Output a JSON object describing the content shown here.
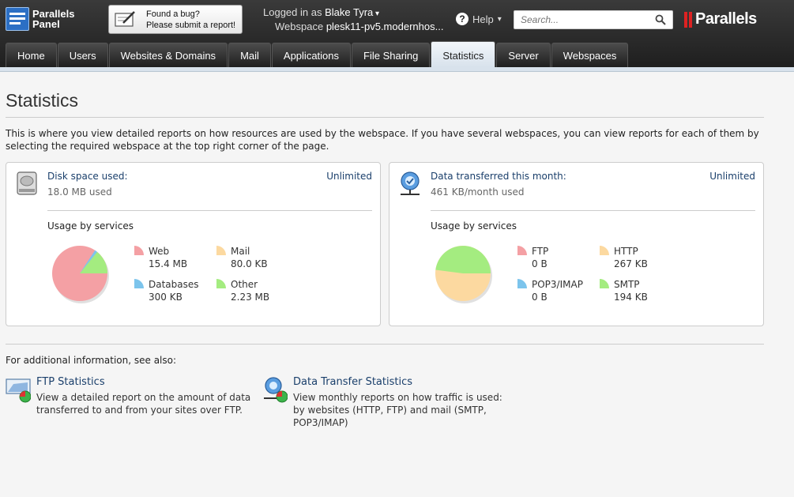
{
  "header": {
    "logo_line1": "Parallels",
    "logo_line2": "Panel",
    "bug_line1": "Found a bug?",
    "bug_line2": "Please submit a report!",
    "logged_in_label": "Logged in as",
    "user_name": "Blake Tyra",
    "webspace_label": "Webspace",
    "webspace_value": "plesk11-pv5.modernhos...",
    "help_label": "Help",
    "search_placeholder": "Search...",
    "brand": "Parallels"
  },
  "tabs": [
    {
      "label": "Home",
      "active": false
    },
    {
      "label": "Users",
      "active": false
    },
    {
      "label": "Websites & Domains",
      "active": false
    },
    {
      "label": "Mail",
      "active": false
    },
    {
      "label": "Applications",
      "active": false
    },
    {
      "label": "File Sharing",
      "active": false
    },
    {
      "label": "Statistics",
      "active": true
    },
    {
      "label": "Server",
      "active": false
    },
    {
      "label": "Webspaces",
      "active": false
    }
  ],
  "page": {
    "title": "Statistics",
    "intro": "This is where you view detailed reports on how resources are used by the webspace. If you have several webspaces, you can view reports for each of them by selecting the required webspace at the top right corner of the page."
  },
  "disk": {
    "title": "Disk space used:",
    "limit": "Unlimited",
    "used": "18.0 MB used",
    "usage_title": "Usage by services",
    "legend": [
      {
        "name": "Web",
        "value": "15.4 MB",
        "color": "#f4a0a4"
      },
      {
        "name": "Mail",
        "value": "80.0 KB",
        "color": "#fcd9a0"
      },
      {
        "name": "Databases",
        "value": "300 KB",
        "color": "#7cc4ec"
      },
      {
        "name": "Other",
        "value": "2.23 MB",
        "color": "#a4ec80"
      }
    ]
  },
  "traffic": {
    "title": "Data transferred this month:",
    "limit": "Unlimited",
    "used": "461 KB/month used",
    "usage_title": "Usage by services",
    "legend": [
      {
        "name": "FTP",
        "value": "0 B",
        "color": "#f4a0a4"
      },
      {
        "name": "HTTP",
        "value": "267 KB",
        "color": "#fcd9a0"
      },
      {
        "name": "POP3/IMAP",
        "value": "0 B",
        "color": "#7cc4ec"
      },
      {
        "name": "SMTP",
        "value": "194 KB",
        "color": "#a4ec80"
      }
    ]
  },
  "see_also": {
    "label": "For additional information, see also:",
    "ftp_title": "FTP Statistics",
    "ftp_desc": "View a detailed report on the amount of data transferred to and from your sites over FTP.",
    "dt_title": "Data Transfer Statistics",
    "dt_desc": "View monthly reports on how traffic is used: by websites (HTTP, FTP) and mail (SMTP, POP3/IMAP)"
  }
}
